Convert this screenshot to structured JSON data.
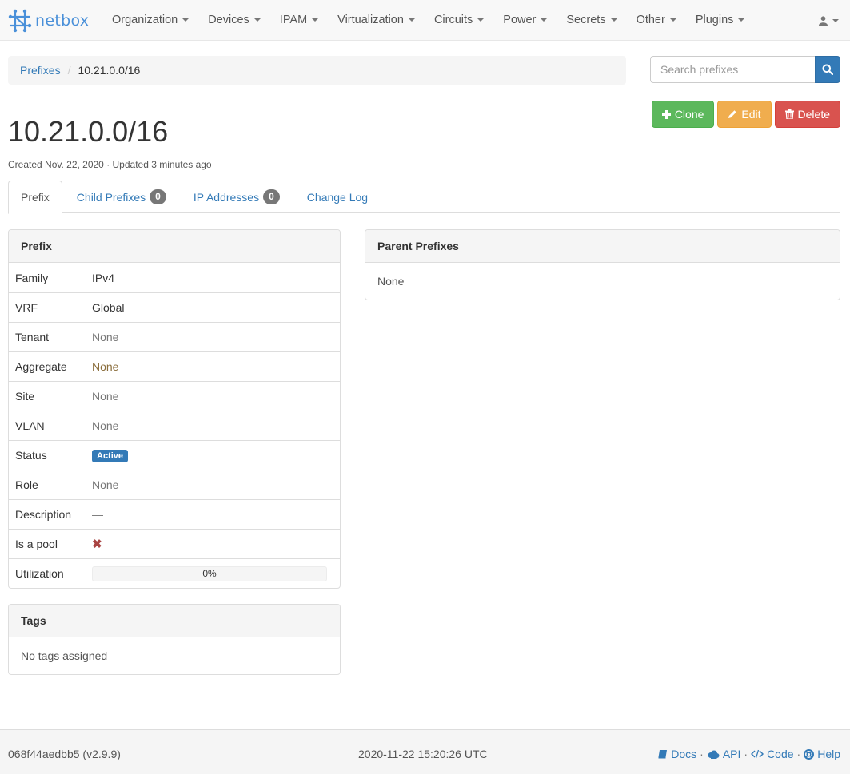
{
  "app": {
    "brand": "netbox"
  },
  "nav": {
    "items": [
      "Organization",
      "Devices",
      "IPAM",
      "Virtualization",
      "Circuits",
      "Power",
      "Secrets",
      "Other",
      "Plugins"
    ]
  },
  "breadcrumb": {
    "parent": "Prefixes",
    "current": "10.21.0.0/16"
  },
  "search": {
    "placeholder": "Search prefixes"
  },
  "actions": {
    "clone": "Clone",
    "edit": "Edit",
    "delete": "Delete"
  },
  "page": {
    "title": "10.21.0.0/16",
    "meta": "Created Nov. 22, 2020 · Updated 3 minutes ago"
  },
  "tabs": [
    {
      "label": "Prefix"
    },
    {
      "label": "Child Prefixes",
      "badge": "0"
    },
    {
      "label": "IP Addresses",
      "badge": "0"
    },
    {
      "label": "Change Log"
    }
  ],
  "prefix_panel": {
    "heading": "Prefix",
    "rows": [
      {
        "label": "Family",
        "value": "IPv4"
      },
      {
        "label": "VRF",
        "value": "Global"
      },
      {
        "label": "Tenant",
        "value": "None"
      },
      {
        "label": "Aggregate",
        "value": "None"
      },
      {
        "label": "Site",
        "value": "None"
      },
      {
        "label": "VLAN",
        "value": "None"
      },
      {
        "label": "Status",
        "value": "Active"
      },
      {
        "label": "Role",
        "value": "None"
      },
      {
        "label": "Description",
        "value": "—"
      },
      {
        "label": "Is a pool",
        "value": "✖"
      },
      {
        "label": "Utilization",
        "value": "0%"
      }
    ],
    "utilization_percent": 0
  },
  "tags_panel": {
    "heading": "Tags",
    "body": "No tags assigned"
  },
  "parent_panel": {
    "heading": "Parent Prefixes",
    "body": "None"
  },
  "footer": {
    "version": "068f44aedbb5 (v2.9.9)",
    "timestamp": "2020-11-22 15:20:26 UTC",
    "links": {
      "docs": "Docs",
      "api": "API",
      "code": "Code",
      "help": "Help"
    },
    "separator": "·"
  },
  "colors": {
    "primary": "#337ab7",
    "success": "#5cb85c",
    "warning": "#f0ad4e",
    "danger": "#d9534f",
    "pool_x": "#a94442"
  }
}
